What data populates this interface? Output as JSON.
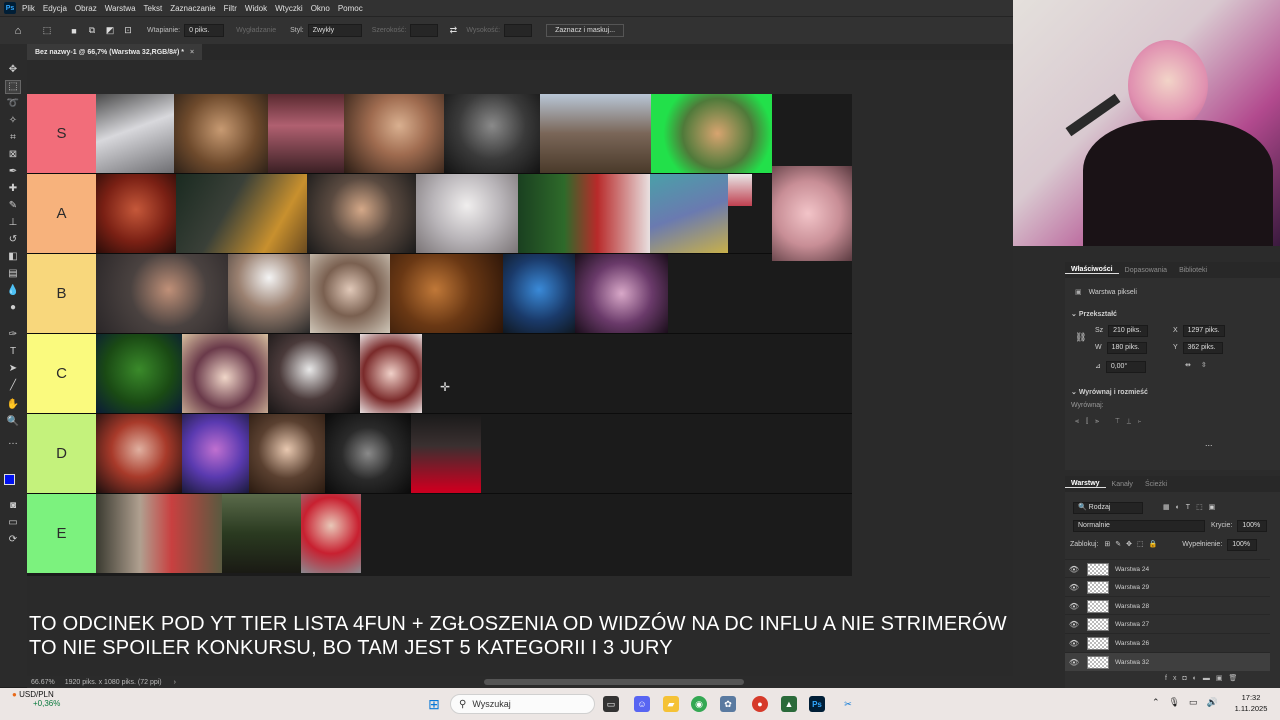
{
  "app": {
    "logo": "Ps",
    "doc_tab": "Bez nazwy-1 @ 66,7% (Warstwa 32,RGB/8#) *",
    "close_glyph": "×"
  },
  "menu": [
    "Plik",
    "Edycja",
    "Obraz",
    "Warstwa",
    "Tekst",
    "Zaznaczanie",
    "Filtr",
    "Widok",
    "Wtyczki",
    "Okno",
    "Pomoc"
  ],
  "options": {
    "feather_label": "Wtapianie:",
    "feather_value": "0 piks.",
    "antialias": "Wygładzanie",
    "style_label": "Styl:",
    "style_value": "Zwykły",
    "width_label": "Szerokość:",
    "height_label": "Wysokość:",
    "mask_button": "Zaznacz i maskuj..."
  },
  "tiers": [
    {
      "label": "S",
      "color": "#f26d7a"
    },
    {
      "label": "A",
      "color": "#f7b27c"
    },
    {
      "label": "B",
      "color": "#f8d77c"
    },
    {
      "label": "C",
      "color": "#fafa7e"
    },
    {
      "label": "D",
      "color": "#c4f27c"
    },
    {
      "label": "E",
      "color": "#7cf27e"
    }
  ],
  "caption": {
    "line1": "TO ODCINEK POD YT TIER LISTA 4FUN + ZGŁOSZENIA OD WIDZÓW NA DC INFLU A NIE STRIMERÓW",
    "line2": "TO NIE SPOILER KONKURSU, BO TAM JEST 5 KATEGORII I 3 JURY"
  },
  "status": {
    "zoom": "66.67%",
    "doc_info": "1920 piks. x 1080 piks. (72 ppi)",
    "arrow": "›"
  },
  "properties": {
    "tabs": [
      "Właściwości",
      "Dopasowania",
      "Biblioteki"
    ],
    "layer_type": "Warstwa pikseli",
    "transform_header": "Przekształć",
    "w_label": "Sz",
    "w_value": "210 piks.",
    "h_label": "W",
    "h_value": "180 piks.",
    "x_label": "X",
    "x_value": "1297 piks.",
    "y_label": "Y",
    "y_value": "362 piks.",
    "angle_value": "0,00°",
    "align_header": "Wyrównaj i rozmieść",
    "align_label": "Wyrównaj:",
    "more": "..."
  },
  "layers_panel": {
    "tabs": [
      "Warstwy",
      "Kanały",
      "Ścieżki"
    ],
    "filter": "Rodzaj",
    "blend_mode": "Normalnie",
    "opacity_label": "Krycie:",
    "opacity_value": "100%",
    "lock_label": "Zablokuj:",
    "fill_label": "Wypełnienie:",
    "fill_value": "100%",
    "layers": [
      "Warstwa 24",
      "Warstwa 29",
      "Warstwa 28",
      "Warstwa 27",
      "Warstwa 26",
      "Warstwa 32"
    ],
    "footer_fx": "fx"
  },
  "taskbar": {
    "ticker": "USD/PLN",
    "ticker_change": "+0,36%",
    "search": "Wyszukaj",
    "time": "17:32",
    "date": "1.11.2025",
    "ps_icon": "Ps"
  }
}
